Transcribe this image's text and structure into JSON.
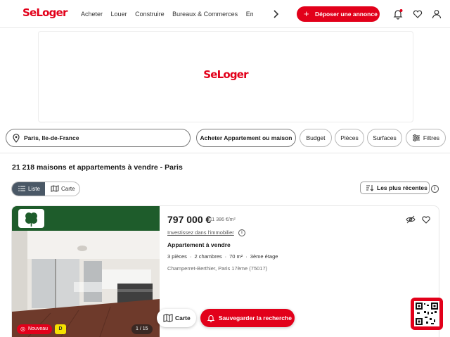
{
  "header": {
    "logo": "SeLoger",
    "nav": [
      "Acheter",
      "Louer",
      "Construire",
      "Bureaux & Commerces",
      "Emprunter"
    ],
    "post_button": "Déposer une annonce"
  },
  "ad": {
    "logo": "SeLoger"
  },
  "search": {
    "location": "Paris, Ile-de-France",
    "transaction": "Acheter Appartement ou maison",
    "filters": [
      "Budget",
      "Pièces",
      "Surfaces"
    ],
    "filters_button": "Filtres"
  },
  "results": {
    "title": "21 218 maisons et appartements à vendre - Paris",
    "view_list": "Liste",
    "view_map": "Carte",
    "sort": "Les plus récentes"
  },
  "listing": {
    "price": "797 000 €",
    "price_per_sqm": "11 386 €/m²",
    "invest_link": "Investissez dans l'immobilier",
    "type": "Appartement à vendre",
    "rooms": "3 pièces",
    "bedrooms": "2 chambres",
    "area": "70 m²",
    "floor": "3ème étage",
    "location": "Champerret-Berthier, Paris 17ème (75017)",
    "badge_new": "Nouveau",
    "energy_class": "D",
    "photo_counter": "1 / 15"
  },
  "floating": {
    "map_button": "Carte",
    "save_search": "Sauvegarder la recherche"
  },
  "colors": {
    "brand": "#e2001a",
    "agency_banner": "#1e5c2b",
    "energy_badge": "#f4e200",
    "toggle_active": "#4a5866"
  },
  "icons": [
    "chevron-right-icon",
    "plus-icon",
    "bell-icon",
    "heart-icon",
    "user-icon",
    "pin-icon",
    "sliders-icon",
    "list-icon",
    "map-icon",
    "sort-icon",
    "info-icon",
    "eye-off-icon",
    "qr-code-icon"
  ]
}
